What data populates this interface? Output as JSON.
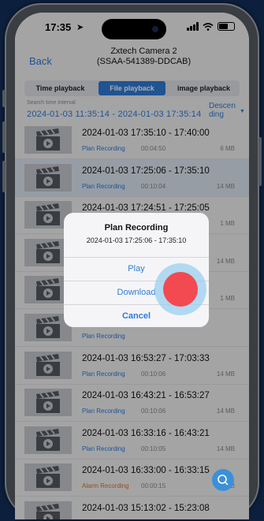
{
  "status": {
    "time": "17:35"
  },
  "header": {
    "back": "Back",
    "title_line1": "Zxtech Camera 2",
    "title_line2": "(SSAA-541389-DDCAB)"
  },
  "tabs": [
    "Time playback",
    "File playback",
    "image playback"
  ],
  "active_tab": 1,
  "search": {
    "label": "Search time interval",
    "range": "2024-01-03 11:35:14 - 2024-01-03 17:35:14",
    "sort_line1": "Descen",
    "sort_line2": "ding"
  },
  "rows": [
    {
      "time": "2024-01-03  17:35:10 - 17:40:00",
      "type": "Plan Recording",
      "duration": "00:04:50",
      "size": "6 MB"
    },
    {
      "time": "2024-01-03  17:25:06 - 17:35:10",
      "type": "Plan Recording",
      "duration": "00:10:04",
      "size": "14 MB"
    },
    {
      "time": "2024-01-03  17:24:51 - 17:25:05",
      "type": "",
      "duration": "",
      "size": "1 MB"
    },
    {
      "time": "51",
      "type": "",
      "duration": "",
      "size": "14 MB"
    },
    {
      "time": "45",
      "type": "",
      "duration": "",
      "size": "1 MB"
    },
    {
      "time": "39",
      "type": "Plan Recording",
      "duration": "",
      "size": ""
    },
    {
      "time": "2024-01-03  16:53:27 - 17:03:33",
      "type": "Plan Recording",
      "duration": "00:10:06",
      "size": "14 MB"
    },
    {
      "time": "2024-01-03  16:43:21 - 16:53:27",
      "type": "Plan Recording",
      "duration": "00:10:06",
      "size": "14 MB"
    },
    {
      "time": "2024-01-03  16:33:16 - 16:43:21",
      "type": "Plan Recording",
      "duration": "00:10:05",
      "size": "14 MB"
    },
    {
      "time": "2024-01-03  16:33:00 - 16:33:15",
      "type": "Alarm Recording",
      "duration": "00:00:15",
      "size": "1 MB"
    },
    {
      "time": "2024-01-03  15:13:02 - 15:23:08",
      "type": "",
      "duration": "",
      "size": ""
    }
  ],
  "selected_row": 1,
  "dialog": {
    "title": "Plan Recording",
    "subtitle": "2024-01-03   17:25:06 - 17:35:10",
    "play": "Play",
    "download": "Download",
    "cancel": "Cancel"
  },
  "colors": {
    "accent": "#2f7bd8",
    "alarm": "#e0702b",
    "record": "#f24a50"
  }
}
